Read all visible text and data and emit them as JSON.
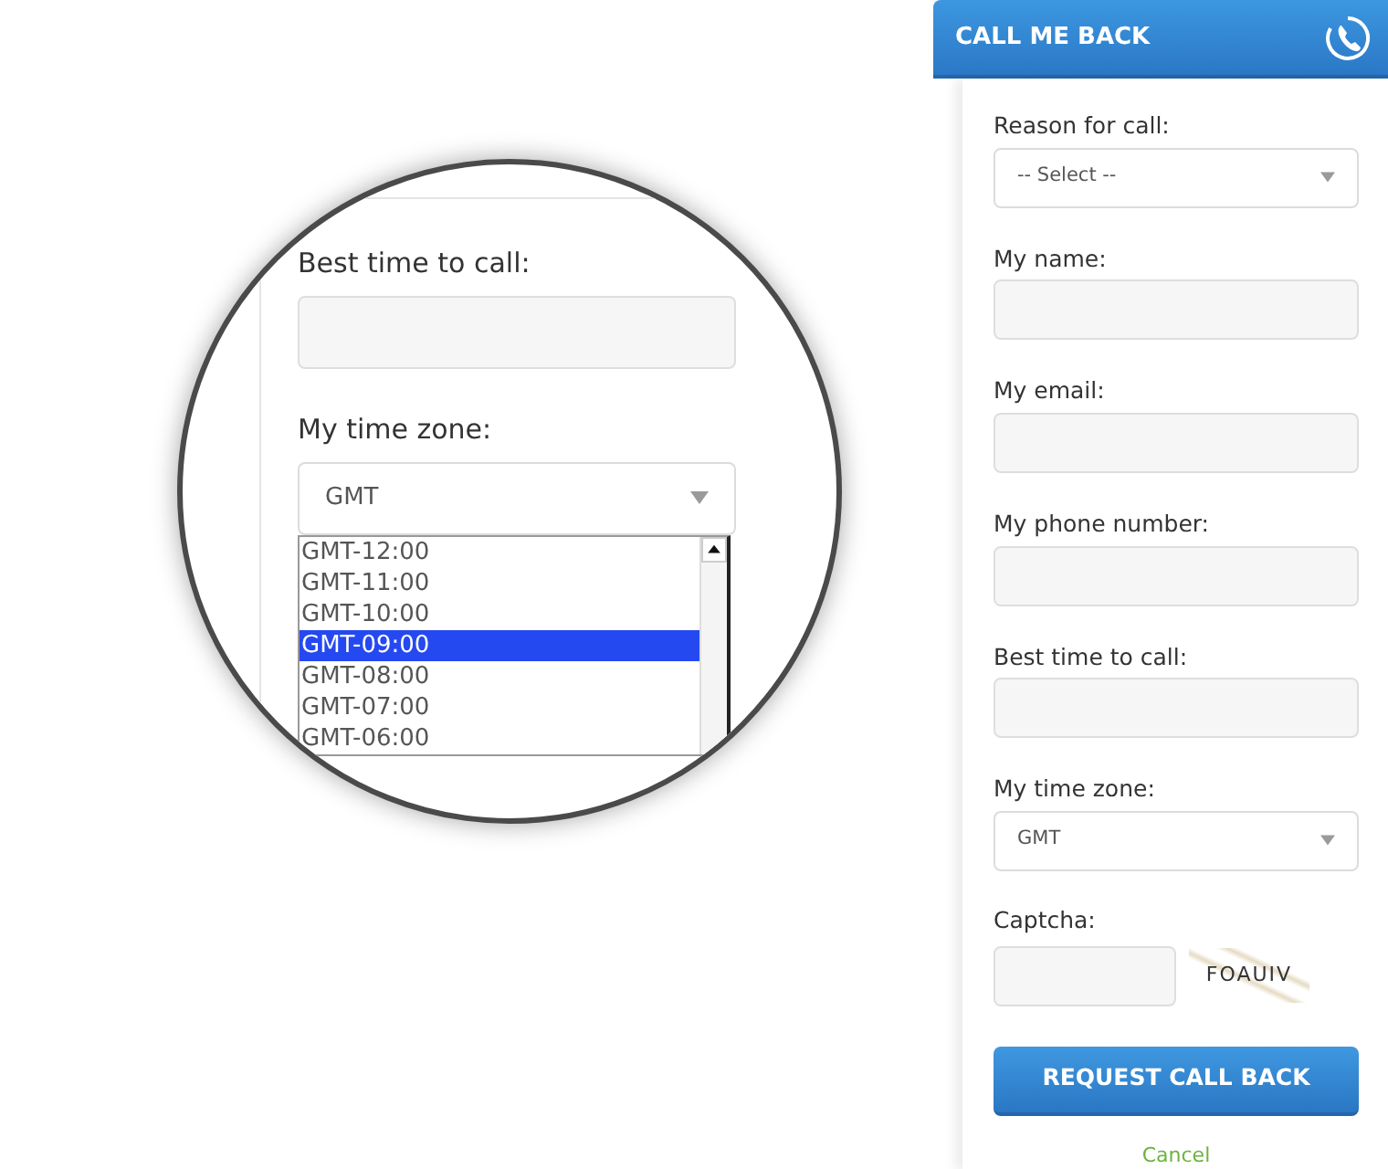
{
  "panel": {
    "title": "CALL ME BACK",
    "fields": [
      {
        "kind": "select",
        "label": "Reason for call:",
        "value": "-- Select --"
      },
      {
        "kind": "text",
        "label": "My name:"
      },
      {
        "kind": "text",
        "label": "My email:"
      },
      {
        "kind": "text",
        "label": "My phone number:"
      },
      {
        "kind": "text",
        "label": "Best time to call:"
      },
      {
        "kind": "select",
        "label": "My time zone:",
        "value": "GMT"
      }
    ],
    "captcha": {
      "label": "Captcha:",
      "code": "FOAUIV"
    },
    "submit": "REQUEST CALL BACK",
    "cancel": "Cancel"
  },
  "magnifier": {
    "fields": [
      {
        "kind": "text",
        "label": "Best time to call:"
      },
      {
        "kind": "select",
        "label": "My time zone:",
        "value": "GMT"
      }
    ],
    "options": [
      {
        "label": "GMT-12:00",
        "selected": false
      },
      {
        "label": "GMT-11:00",
        "selected": false
      },
      {
        "label": "GMT-10:00",
        "selected": false
      },
      {
        "label": "GMT-09:00",
        "selected": true
      },
      {
        "label": "GMT-08:00",
        "selected": false
      },
      {
        "label": "GMT-07:00",
        "selected": false
      },
      {
        "label": "GMT-06:00",
        "selected": false
      }
    ]
  }
}
